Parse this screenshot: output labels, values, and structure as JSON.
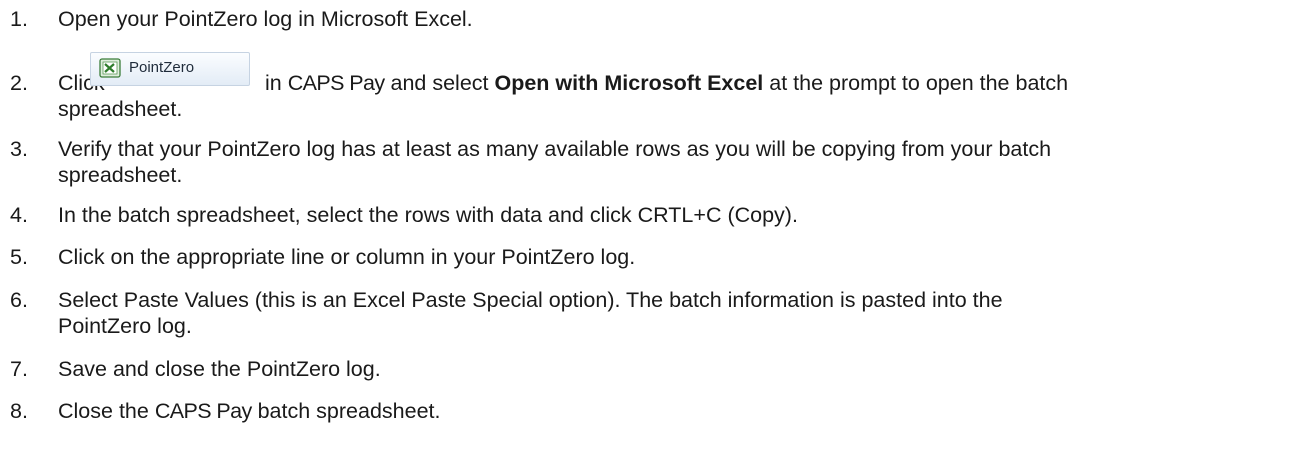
{
  "steps": [
    {
      "num": "1.",
      "text": "Open your PointZero log in Microsoft Excel."
    },
    {
      "num": "2.",
      "click": "Click",
      "after_button": "in",
      "caps_pay": "CAPS Pay",
      "and_select": "and select",
      "bold": "Open with Microsoft Excel",
      "tail": "at the prompt to open the batch",
      "line2": "spreadsheet."
    },
    {
      "num": "3.",
      "text": "Verify that your PointZero log has at least as many available rows as you will be copying from your batch",
      "line2": "spreadsheet."
    },
    {
      "num": "4.",
      "text": "In the batch spreadsheet, select the rows with data and click CRTL+C (Copy)."
    },
    {
      "num": "5.",
      "text": "Click on the appropriate line or column in your PointZero log."
    },
    {
      "num": "6.",
      "text": "Select Paste Values (this is an Excel Paste Special option). The batch information is pasted into the",
      "line2": "PointZero log."
    },
    {
      "num": "7.",
      "text": "Save and close the PointZero log."
    },
    {
      "num": "8.",
      "pre": "Close the",
      "caps_pay": "CAPS Pay",
      "post": "batch spreadsheet."
    }
  ],
  "button": {
    "label": "PointZero",
    "icon": "excel-icon"
  }
}
